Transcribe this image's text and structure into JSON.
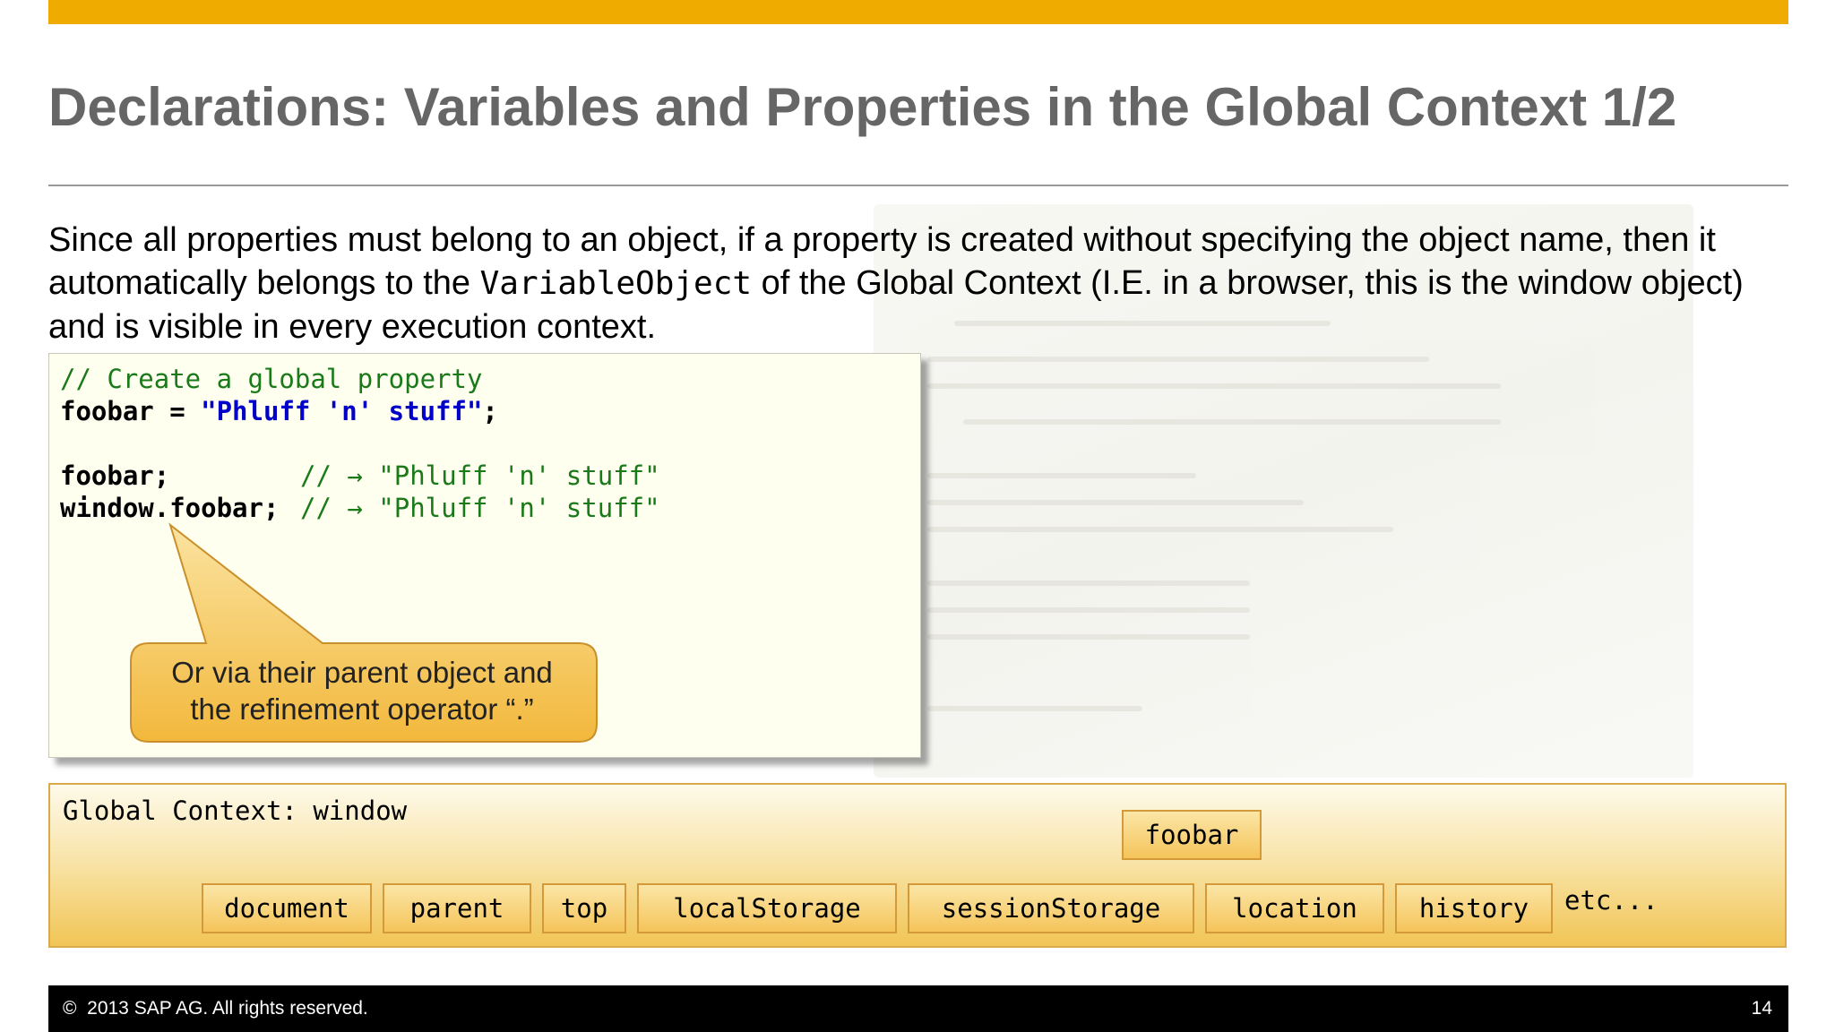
{
  "slide": {
    "title": "Declarations: Variables and Properties in the Global Context 1/2",
    "colors": {
      "accent_bar": "#f0ab00",
      "title": "#666666",
      "comment": "#1a7a1a",
      "string": "#0000c8",
      "callout_fill": "#f5c45a",
      "global_box_border": "#d9a94c"
    }
  },
  "intro": {
    "part1": "Since all properties must belong to an object, if a property is created without specifying the object name, then it automatically belongs to the ",
    "code": "VariableObject",
    "part2": " of the Global Context (I.E. in a browser, this is the window object) and is visible in every  execution context."
  },
  "code": {
    "line1_comment": "// Create a global property",
    "line2_ident": "foobar = ",
    "line2_string": "\"Phluff 'n' stuff\"",
    "line2_end": ";",
    "line4_ident": "foobar;",
    "line4_comment": "// → \"Phluff 'n' stuff\"",
    "line5_ident": "window.foobar;",
    "line5_comment": "// → \"Phluff 'n' stuff\""
  },
  "callout": {
    "line1": "Or via their parent object and",
    "line2": "the refinement operator “.”"
  },
  "global_context": {
    "label": "Global Context: window",
    "new_property": "foobar",
    "properties": [
      "document",
      "parent",
      "top",
      "localStorage",
      "sessionStorage",
      "location",
      "history"
    ],
    "etc": "etc..."
  },
  "footer": {
    "copyright": "©  2013 SAP AG. All rights reserved.",
    "page_number": "14"
  }
}
